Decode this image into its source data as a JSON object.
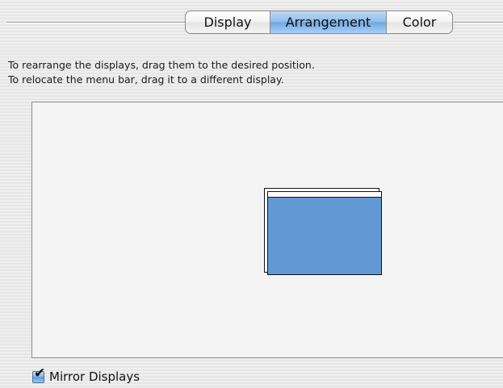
{
  "tabs": [
    {
      "label": "Display",
      "selected": false
    },
    {
      "label": "Arrangement",
      "selected": true
    },
    {
      "label": "Color",
      "selected": false
    }
  ],
  "instructions": {
    "line1": "To rearrange the displays, drag them to the desired position.",
    "line2": "To relocate the menu bar, drag it to a different display."
  },
  "mirror_displays": {
    "label": "Mirror Displays",
    "checked": true
  },
  "colors": {
    "display_fill": "#6298d4",
    "selected_tab": "#8ebdea"
  },
  "icons": {
    "check": "checkmark-icon"
  }
}
